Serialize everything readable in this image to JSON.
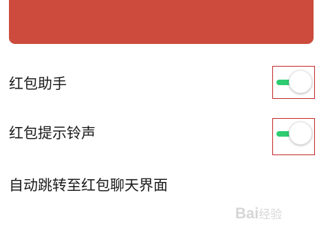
{
  "settings": {
    "items": [
      {
        "label": "红包助手",
        "enabled": true
      },
      {
        "label": "红包提示铃声",
        "enabled": true
      },
      {
        "label": "自动跳转至红包聊天界面"
      }
    ]
  },
  "colors": {
    "banner": "#cc4b3c",
    "toggle_on": "#2ecc71",
    "highlight": "#c22222"
  },
  "watermark": {
    "brand": "Bai",
    "sub": "经验"
  }
}
